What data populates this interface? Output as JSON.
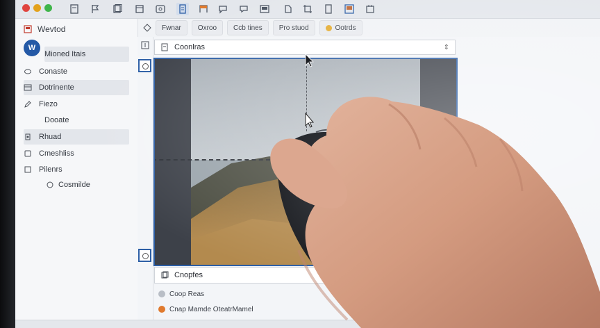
{
  "window": {
    "traffic_lights": [
      "#e0443e",
      "#e3a21c",
      "#3fb54a"
    ],
    "toolbar_icons": [
      "document-icon",
      "flag-icon",
      "copy-icon",
      "frame-icon",
      "image-icon",
      "list-icon",
      "bookmark-icon",
      "message-icon",
      "chat-icon",
      "picture-icon",
      "export-icon",
      "crop-icon",
      "rectangle-icon",
      "gallery-icon",
      "calendar-icon"
    ]
  },
  "sidebar": {
    "header": "Wevtod",
    "logo": "W",
    "items": [
      {
        "label": "Mioned Itais",
        "icon": "none",
        "selected": true
      },
      {
        "label": "Conaste",
        "icon": "layers-icon",
        "selected": false
      },
      {
        "label": "Dotrinente",
        "icon": "panel-icon",
        "selected": true
      },
      {
        "label": "Fiezo",
        "icon": "edit-icon",
        "selected": false
      },
      {
        "label": "Dooate",
        "icon": "none",
        "selected": false
      },
      {
        "label": "Rhuad",
        "icon": "gear-icon",
        "selected": true
      },
      {
        "label": "Cmeshliss",
        "icon": "square-icon",
        "selected": false
      },
      {
        "label": "Pilenrs",
        "icon": "square-icon",
        "selected": false
      },
      {
        "label": "Cosmilde",
        "icon": "circle-icon",
        "selected": false
      }
    ]
  },
  "toolbar": {
    "chips": [
      "Fwnar",
      "Oxroo",
      "Ccb tines",
      "Pro stuod",
      "Ootrds"
    ]
  },
  "document": {
    "title": "Coonlras",
    "footer_label": "Cnopfes",
    "meta": [
      {
        "label": "Coop Reas",
        "color": "#b9bec6"
      },
      {
        "label": "Cnap Mamde OteatrMamel",
        "color": "#e07a2e"
      }
    ]
  },
  "colors": {
    "accent": "#2d5fa6",
    "skin": "#d9a48b"
  }
}
